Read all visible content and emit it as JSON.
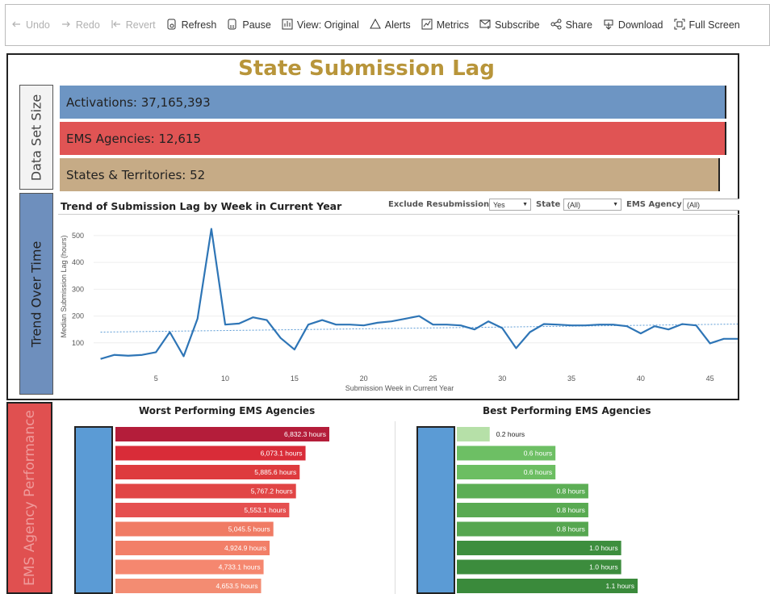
{
  "toolbar": {
    "items": [
      {
        "label": "Undo",
        "icon": "undo-icon",
        "enabled": false
      },
      {
        "label": "Redo",
        "icon": "redo-icon",
        "enabled": false
      },
      {
        "label": "Revert",
        "icon": "revert-icon",
        "enabled": false
      },
      {
        "label": "Refresh",
        "icon": "refresh-icon",
        "enabled": true
      },
      {
        "label": "Pause",
        "icon": "pause-icon",
        "enabled": true
      },
      {
        "label": "View: Original",
        "icon": "view-icon",
        "enabled": true
      },
      {
        "label": "Alerts",
        "icon": "alert-bell-icon",
        "enabled": true
      },
      {
        "label": "Metrics",
        "icon": "metrics-icon",
        "enabled": true
      },
      {
        "label": "Subscribe",
        "icon": "subscribe-mail-icon",
        "enabled": true
      },
      {
        "label": "Share",
        "icon": "share-icon",
        "enabled": true
      },
      {
        "label": "Download",
        "icon": "download-icon",
        "enabled": true
      },
      {
        "label": "Full Screen",
        "icon": "fullscreen-icon",
        "enabled": true
      }
    ]
  },
  "dashboard": {
    "title": "State Submission Lag",
    "tabs": {
      "data_set_size": "Data Set Size",
      "trend_over_time": "Trend Over Time",
      "ems_agency_performance": "EMS Agency Performance"
    },
    "stats": {
      "activations": "Activations: 37,165,393",
      "agencies": "EMS Agencies: 12,615",
      "states": "States & Territories: 52"
    },
    "colors": {
      "activations": "#6d95c3",
      "agencies": "#e05454",
      "states": "#c6ab86",
      "title": "#b8953a",
      "line": "#2e75b6"
    },
    "trend": {
      "title": "Trend of Submission Lag by Week in Current Year",
      "filters": {
        "exclude_label": "Exclude Resubmissions",
        "exclude_value": "Yes",
        "state_label": "State",
        "state_value": "(All)",
        "agency_label": "EMS Agency",
        "agency_value": "(All)"
      }
    },
    "worst": {
      "title": "Worst Performing EMS Agencies",
      "bars": [
        {
          "value": 6832.3,
          "label": "6,832.3 hours"
        },
        {
          "value": 6073.1,
          "label": "6,073.1 hours"
        },
        {
          "value": 5885.6,
          "label": "5,885.6 hours"
        },
        {
          "value": 5767.2,
          "label": "5,767.2 hours"
        },
        {
          "value": 5553.1,
          "label": "5,553.1 hours"
        },
        {
          "value": 5045.5,
          "label": "5,045.5 hours"
        },
        {
          "value": 4924.9,
          "label": "4,924.9 hours"
        },
        {
          "value": 4733.1,
          "label": "4,733.1 hours"
        },
        {
          "value": 4653.5,
          "label": "4,653.5 hours"
        }
      ],
      "colors": [
        "#b41d3a",
        "#d92c38",
        "#de3b3e",
        "#e14545",
        "#e55050",
        "#f07b64",
        "#f27f68",
        "#f5876f",
        "#f38c72"
      ]
    },
    "best": {
      "title": "Best Performing EMS Agencies",
      "bars": [
        {
          "value": 0.2,
          "label": "0.2 hours"
        },
        {
          "value": 0.6,
          "label": "0.6 hours"
        },
        {
          "value": 0.6,
          "label": "0.6 hours"
        },
        {
          "value": 0.8,
          "label": "0.8 hours"
        },
        {
          "value": 0.8,
          "label": "0.8 hours"
        },
        {
          "value": 0.8,
          "label": "0.8 hours"
        },
        {
          "value": 1.0,
          "label": "1.0 hours"
        },
        {
          "value": 1.0,
          "label": "1.0 hours"
        },
        {
          "value": 1.1,
          "label": "1.1 hours"
        }
      ],
      "colors": [
        "#b6e0a8",
        "#6dbf64",
        "#6cbe62",
        "#5cae55",
        "#59aa52",
        "#56a650",
        "#3d8e3e",
        "#3c8c3d",
        "#3a8a3b"
      ]
    }
  },
  "chart_data": {
    "type": "line",
    "title": "Trend of Submission Lag by Week in Current Year",
    "xlabel": "Submission Week in Current Year",
    "ylabel": "Median Submission Lag (hours)",
    "x": [
      1,
      2,
      3,
      4,
      5,
      6,
      7,
      8,
      9,
      10,
      11,
      12,
      13,
      14,
      15,
      16,
      17,
      18,
      19,
      20,
      21,
      22,
      23,
      24,
      25,
      26,
      27,
      28,
      29,
      30,
      31,
      32,
      33,
      34,
      35,
      36,
      37,
      38,
      39,
      40,
      41,
      42,
      43,
      44,
      45,
      46,
      47
    ],
    "y": [
      40,
      55,
      52,
      55,
      65,
      140,
      50,
      190,
      525,
      168,
      172,
      195,
      185,
      118,
      75,
      168,
      185,
      168,
      168,
      165,
      175,
      180,
      190,
      200,
      168,
      168,
      165,
      150,
      180,
      155,
      80,
      140,
      170,
      168,
      165,
      165,
      168,
      168,
      162,
      135,
      162,
      150,
      170,
      165,
      98,
      115,
      115
    ],
    "trend_line": {
      "start": 140,
      "end": 170
    },
    "xticks": [
      5,
      10,
      15,
      20,
      25,
      30,
      35,
      40,
      45
    ],
    "yticks": [
      100,
      200,
      300,
      400,
      500
    ],
    "xlim": [
      0.5,
      47
    ],
    "ylim": [
      0,
      560
    ]
  }
}
